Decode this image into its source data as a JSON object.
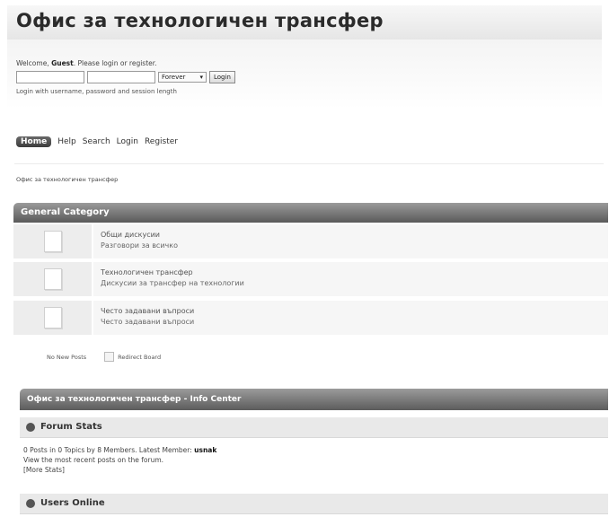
{
  "header": {
    "title": "Офис за технологичен трансфер"
  },
  "login": {
    "welcome_prefix": "Welcome, ",
    "guest": "Guest",
    "welcome_suffix": ". Please login or register.",
    "username_value": "",
    "password_value": "",
    "length_value": "Forever",
    "login_button": "Login",
    "hint": "Login with username, password and session length"
  },
  "menu": {
    "home": "Home",
    "help": "Help",
    "search": "Search",
    "login": "Login",
    "register": "Register"
  },
  "linktree": "Офис за технологичен трансфер",
  "category": {
    "title": "General Category"
  },
  "boards": [
    {
      "name": "Общи дискусии",
      "desc": "Разговори за всичко"
    },
    {
      "name": "Технологичен трансфер",
      "desc": "Дискусии за трансфер на технологии"
    },
    {
      "name": "Често задавани въпроси",
      "desc": "Често задавани въпроси"
    }
  ],
  "legend": {
    "no_new": "No New Posts",
    "redirect": "Redirect Board"
  },
  "info_center": {
    "title": "Офис за технологичен трансфер - Info Center",
    "forum_stats": "Forum Stats",
    "stats_line1_prefix": "0 Posts in 0 Topics by 8 Members. Latest Member: ",
    "latest_member": "usnak",
    "stats_line2": "View the most recent posts on the forum.",
    "stats_line3": "[More Stats]",
    "users_online": "Users Online"
  }
}
